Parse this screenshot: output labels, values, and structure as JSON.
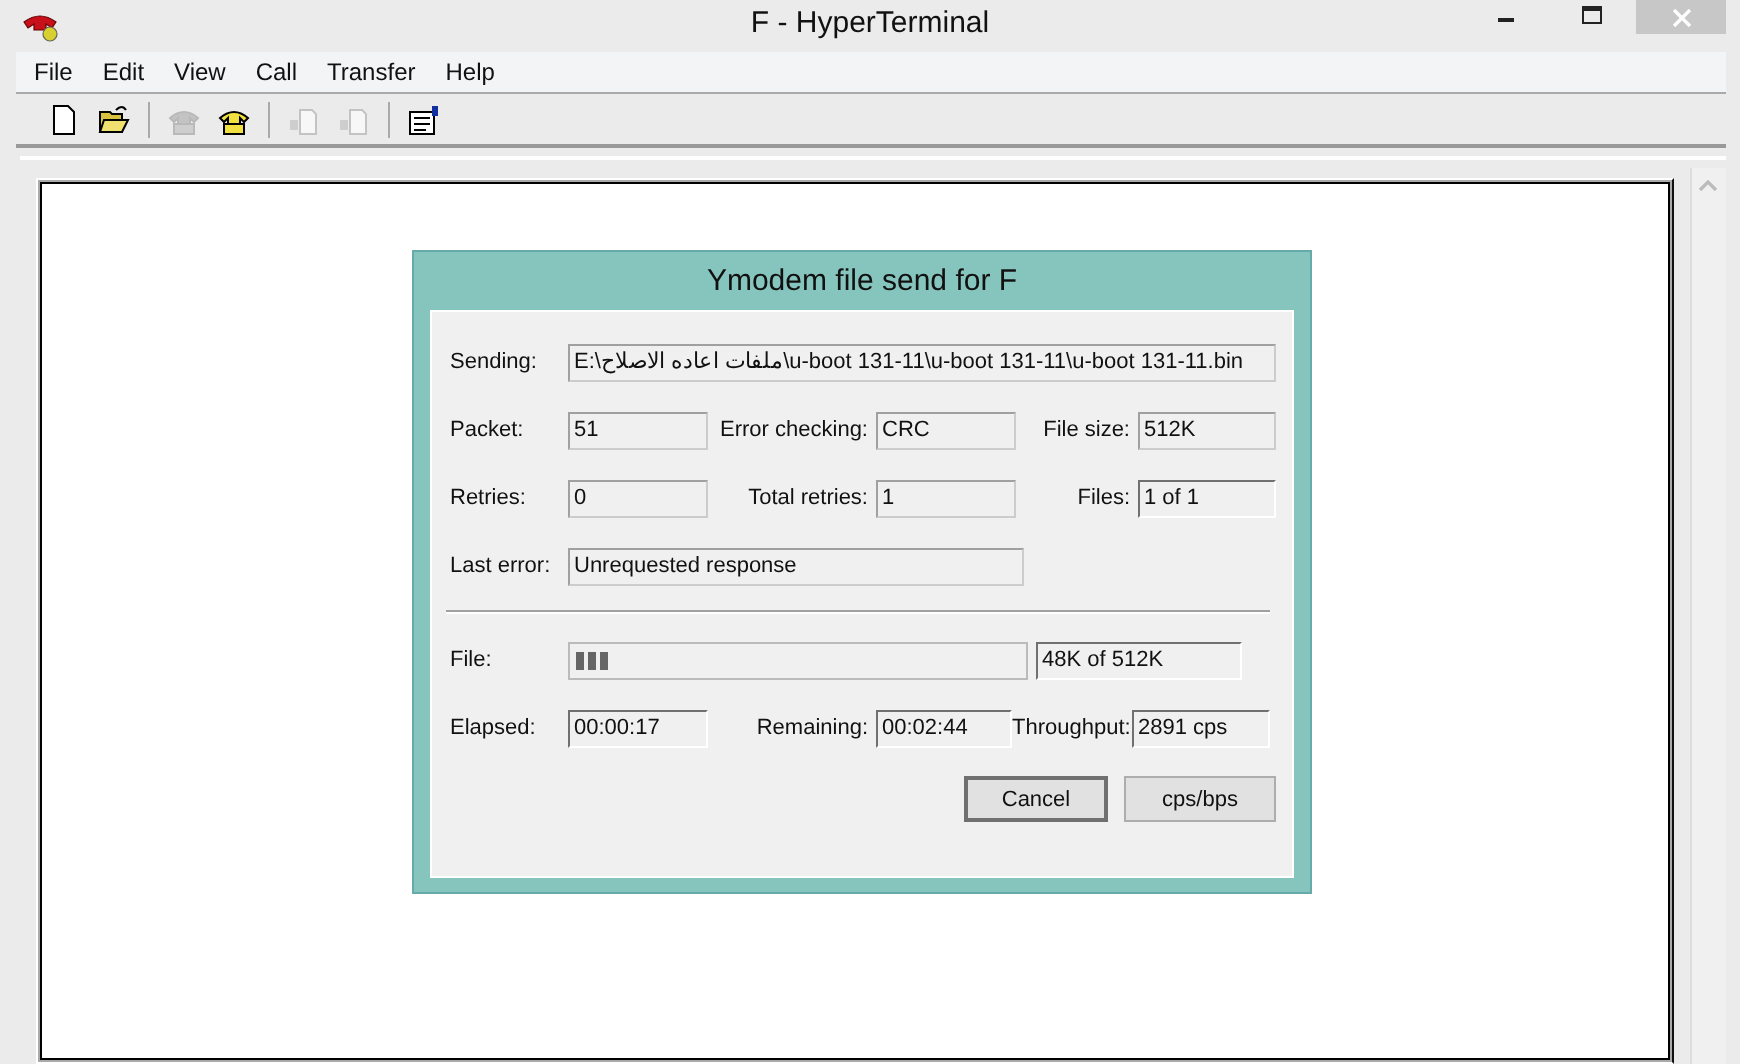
{
  "window": {
    "title": "F - HyperTerminal"
  },
  "menu": [
    "File",
    "Edit",
    "View",
    "Call",
    "Transfer",
    "Help"
  ],
  "toolbar": [
    [
      {
        "kind": "new",
        "disabled": false
      },
      {
        "kind": "open",
        "disabled": false
      }
    ],
    [
      {
        "kind": "disconnect",
        "disabled": true
      },
      {
        "kind": "dial",
        "disabled": false
      }
    ],
    [
      {
        "kind": "send",
        "disabled": true
      },
      {
        "kind": "receive",
        "disabled": true
      }
    ],
    [
      {
        "kind": "properties",
        "disabled": false
      }
    ]
  ],
  "dialog": {
    "title": "Ymodem file send for F",
    "sending": {
      "label": "Sending:",
      "value": "E:\\ملفات اعاده الاصلاح\\u-boot 131-11\\u-boot 131-11\\u-boot 131-11.bin"
    },
    "packet": {
      "label": "Packet:",
      "value": "51"
    },
    "error_checking": {
      "label": "Error checking:",
      "value": "CRC"
    },
    "file_size": {
      "label": "File size:",
      "value": "512K"
    },
    "retries": {
      "label": "Retries:",
      "value": "0"
    },
    "total_retries": {
      "label": "Total retries:",
      "value": "1"
    },
    "files": {
      "label": "Files:",
      "value": "1 of 1"
    },
    "last_error": {
      "label": "Last error:",
      "value": "Unrequested response"
    },
    "file": {
      "label": "File:",
      "level": 0.08,
      "value": "48K of 512K"
    },
    "elapsed": {
      "label": "Elapsed:",
      "value": "00:00:17"
    },
    "remaining": {
      "label": "Remaining:",
      "value": "00:02:44"
    },
    "throughput": {
      "label": "Throughput:",
      "value": "2891 cps"
    },
    "buttons": [
      "Cancel",
      "cps/bps"
    ]
  }
}
